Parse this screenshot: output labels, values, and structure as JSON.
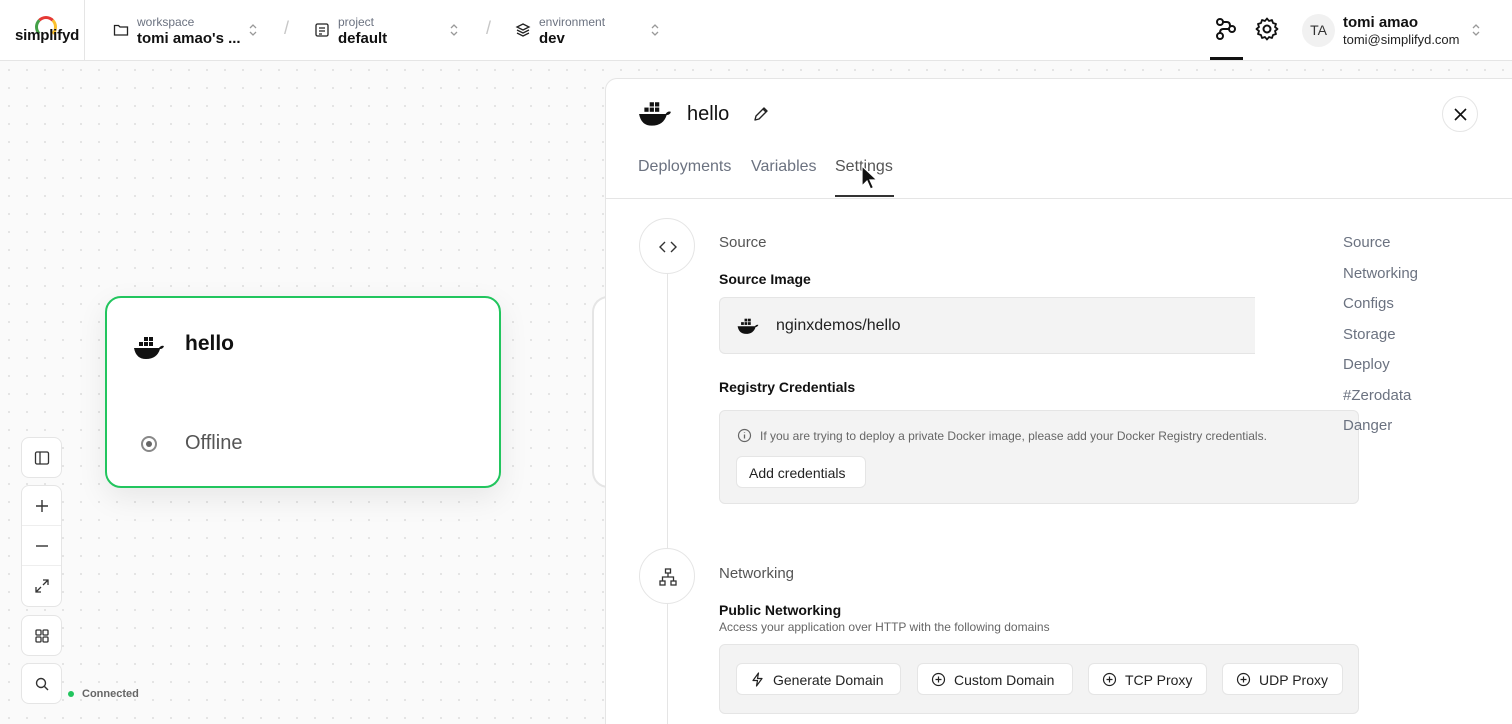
{
  "app": {
    "logo_text": "simplifyd"
  },
  "breadcrumb": {
    "workspace": {
      "label": "workspace",
      "value": "tomi amao's ..."
    },
    "project": {
      "label": "project",
      "value": "default"
    },
    "environment": {
      "label": "environment",
      "value": "dev"
    }
  },
  "user": {
    "initials": "TA",
    "name": "tomi amao",
    "email": "tomi@simplifyd.com"
  },
  "canvas": {
    "node": {
      "title": "hello",
      "status": "Offline"
    },
    "connection_status": "Connected"
  },
  "panel": {
    "title": "hello",
    "tabs": [
      "Deployments",
      "Variables",
      "Settings"
    ],
    "active_tab": "Settings",
    "source": {
      "section_title": "Source",
      "image_label": "Source Image",
      "image_value": "nginxdemos/hello",
      "credentials_label": "Registry Credentials",
      "credentials_message": "If you are trying to deploy a private Docker image, please add your Docker Registry credentials.",
      "add_credentials_button": "Add credentials"
    },
    "networking": {
      "section_title": "Networking",
      "public_title": "Public Networking",
      "public_desc": "Access your application over HTTP with the following domains",
      "buttons": [
        "Generate Domain",
        "Custom Domain",
        "TCP Proxy",
        "UDP Proxy"
      ]
    },
    "toc": [
      "Source",
      "Networking",
      "Configs",
      "Storage",
      "Deploy",
      "#Zerodata",
      "Danger"
    ]
  },
  "colors": {
    "node_border": "#22c55e",
    "connected_dot": "#22c55e"
  }
}
